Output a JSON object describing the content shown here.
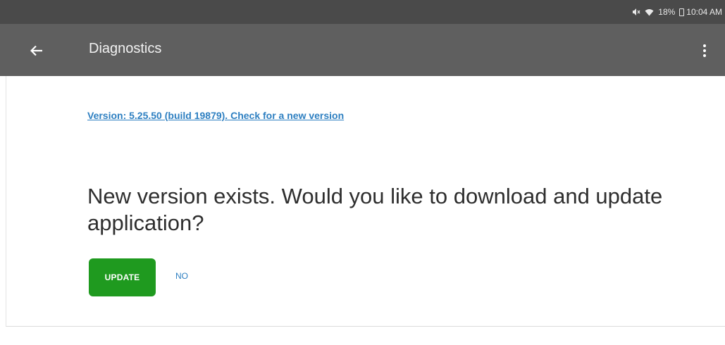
{
  "status_bar": {
    "icons": [
      "mute-icon",
      "wifi-icon",
      "battery-icon"
    ],
    "battery": "18%",
    "time": "10:04 AM"
  },
  "app_bar": {
    "back_icon": "arrow-left-icon",
    "title": "Diagnostics",
    "overflow_icon": "more-vert-icon",
    "background_color": "#5f5f5f"
  },
  "main": {
    "version_link": "Version: 5.25.50 (build 19879). Check for a new version",
    "message": "New version exists. Would you like to download and update application?",
    "update_button": "UPDATE",
    "no_button": "NO",
    "accent_color": "#1f9a1f",
    "link_color": "#2d7fc1"
  }
}
